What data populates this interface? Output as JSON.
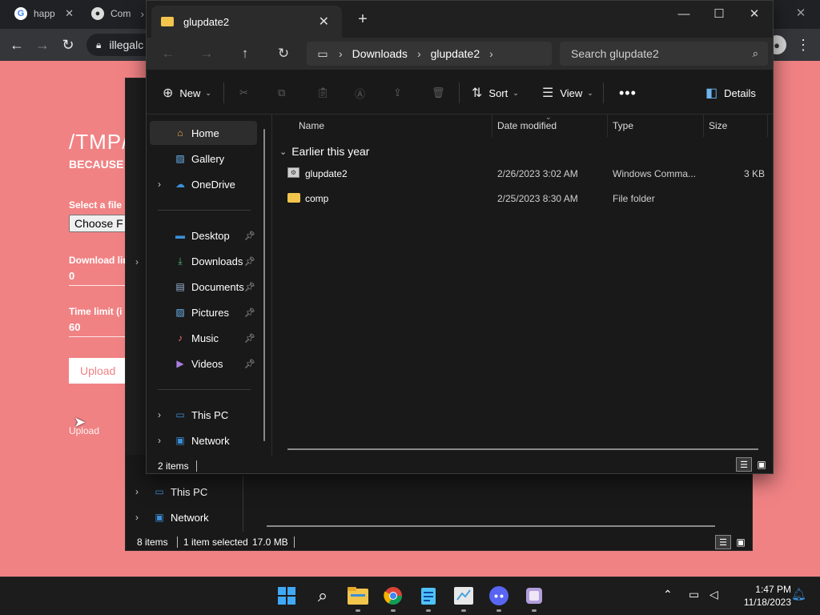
{
  "browser": {
    "tabs": [
      {
        "label": "happ",
        "icon": "google-icon"
      },
      {
        "label": "Com",
        "icon": "github-icon"
      }
    ],
    "omnibox_text": "illegalc"
  },
  "webpage": {
    "title": "/TMP/",
    "subtitle": "BECAUSE",
    "select_file_label": "Select a file (",
    "choose_file_button": "Choose F",
    "download_limit_label": "Download lin",
    "download_limit_value": "0",
    "time_limit_label": "Time limit (i",
    "time_limit_value": "60",
    "upload_button": "Upload",
    "upload_link": "Upload"
  },
  "back_window": {
    "nav_items": [
      {
        "label": "This PC",
        "icon": "this-pc-icon"
      },
      {
        "label": "Network",
        "icon": "network-icon"
      }
    ],
    "status": {
      "items": "8 items",
      "selected": "1 item selected",
      "size": "17.0 MB"
    }
  },
  "explorer": {
    "tab_title": "glupdate2",
    "breadcrumbs": [
      "Downloads",
      "glupdate2"
    ],
    "search_placeholder": "Search glupdate2",
    "commands": {
      "new": "New",
      "sort": "Sort",
      "view": "View",
      "details": "Details"
    },
    "nav_pane": {
      "top": [
        {
          "label": "Home",
          "icon": "home-icon"
        },
        {
          "label": "Gallery",
          "icon": "gallery-icon"
        },
        {
          "label": "OneDrive",
          "icon": "onedrive-icon"
        }
      ],
      "quick_access": [
        {
          "label": "Desktop",
          "icon": "desktop-icon"
        },
        {
          "label": "Downloads",
          "icon": "downloads-icon"
        },
        {
          "label": "Documents",
          "icon": "documents-icon"
        },
        {
          "label": "Pictures",
          "icon": "pictures-icon"
        },
        {
          "label": "Music",
          "icon": "music-icon"
        },
        {
          "label": "Videos",
          "icon": "videos-icon"
        }
      ],
      "bottom": [
        {
          "label": "This PC",
          "icon": "this-pc-icon"
        },
        {
          "label": "Network",
          "icon": "network-icon"
        }
      ]
    },
    "columns": [
      "Name",
      "Date modified",
      "Type",
      "Size"
    ],
    "group_label": "Earlier this year",
    "files": [
      {
        "name": "glupdate2",
        "date": "2/26/2023 3:02 AM",
        "type": "Windows Comma...",
        "size": "3 KB",
        "icon": "batch-file-icon"
      },
      {
        "name": "comp",
        "date": "2/25/2023 8:30 AM",
        "type": "File folder",
        "size": "",
        "icon": "folder-icon"
      }
    ],
    "status_items": "2 items"
  },
  "taskbar": {
    "apps": [
      "start-icon",
      "search-icon",
      "file-explorer-icon",
      "chrome-icon",
      "notepad-icon",
      "paint-icon",
      "discord-icon",
      "app-icon"
    ],
    "time": "1:47 PM",
    "date": "11/18/2023"
  },
  "colors": {
    "page_bg": "#f08284",
    "window_bg": "#191919",
    "folder": "#f3c54c",
    "accent": "#3b8fd9"
  }
}
